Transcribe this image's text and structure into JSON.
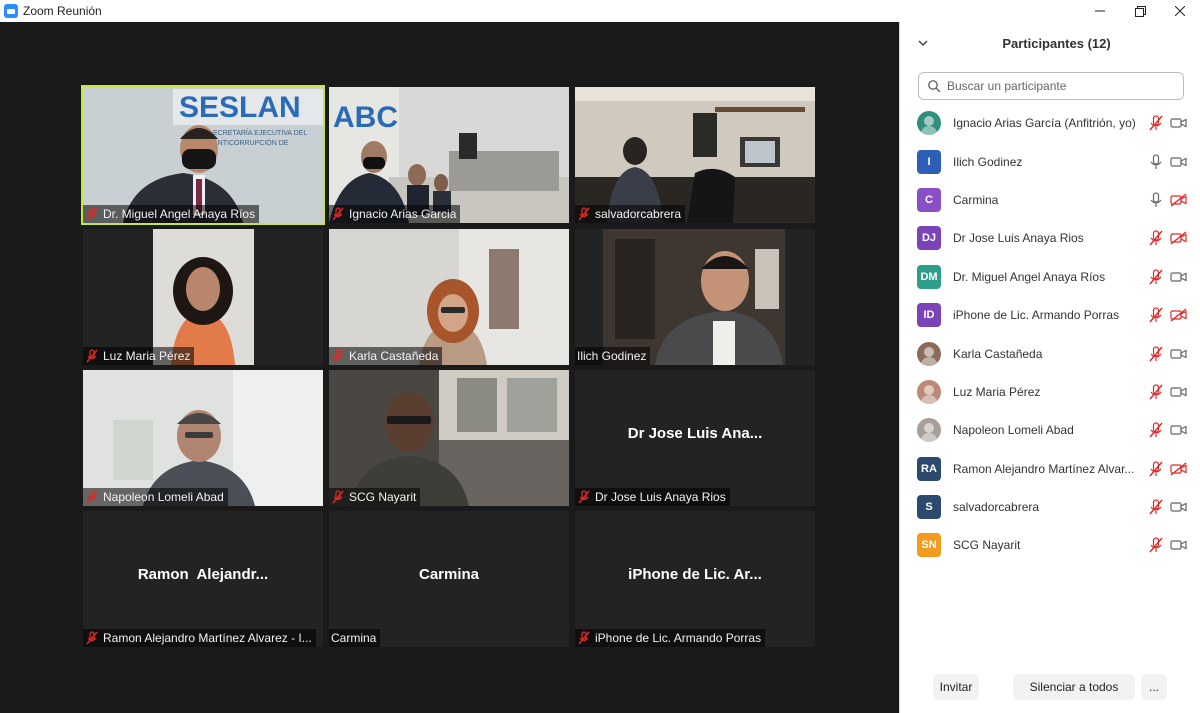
{
  "window": {
    "title": "Zoom Reunión"
  },
  "tiles": [
    {
      "label": "Dr. Miguel Angel Anaya Ríos",
      "big": ""
    },
    {
      "label": "Ignacio Arias Garcia",
      "big": ""
    },
    {
      "label": "salvadorcabrera",
      "big": ""
    },
    {
      "label": "Luz Maria Pérez",
      "big": ""
    },
    {
      "label": "Karla Castañeda",
      "big": ""
    },
    {
      "label": "Ilich Godinez",
      "big": ""
    },
    {
      "label": "Napoleon Lomeli Abad",
      "big": ""
    },
    {
      "label": "SCG Nayarit",
      "big": ""
    },
    {
      "label": "Dr Jose Luis Anaya Rios",
      "big": "Dr Jose Luis Ana..."
    },
    {
      "label": "Ramon Alejandro Martínez Alvarez - I...",
      "big": "Ramon  Alejandr..."
    },
    {
      "label": "Carmina",
      "big": "Carmina"
    },
    {
      "label": "iPhone de Lic. Armando Porras",
      "big": "iPhone de Lic. Ar..."
    }
  ],
  "panel": {
    "title": "Participantes (12)",
    "search_placeholder": "Buscar un participante",
    "participants": [
      {
        "name": "Ignacio Arias García (Anfitrión, yo)",
        "initials": "",
        "color": "#2f8f7a",
        "mic": "muted",
        "video": "on"
      },
      {
        "name": "Ilich Godinez",
        "initials": "I",
        "color": "#2e5fb8",
        "mic": "on",
        "video": "on"
      },
      {
        "name": "Carmina",
        "initials": "C",
        "color": "#8a4fc6",
        "mic": "on",
        "video": "off"
      },
      {
        "name": "Dr Jose Luis Anaya Rios",
        "initials": "DJ",
        "color": "#7a44b8",
        "mic": "muted",
        "video": "off"
      },
      {
        "name": "Dr. Miguel Angel Anaya Ríos",
        "initials": "DM",
        "color": "#2f9d8a",
        "mic": "muted",
        "video": "on"
      },
      {
        "name": "iPhone de Lic. Armando Porras",
        "initials": "ID",
        "color": "#7a44b8",
        "mic": "muted",
        "video": "off"
      },
      {
        "name": "Karla Castañeda",
        "initials": "",
        "color": "#8a6a5a",
        "mic": "muted",
        "video": "on"
      },
      {
        "name": "Luz Maria Pérez",
        "initials": "",
        "color": "#b98a78",
        "mic": "muted",
        "video": "on"
      },
      {
        "name": "Napoleon Lomeli Abad",
        "initials": "",
        "color": "#a89e98",
        "mic": "muted",
        "video": "on"
      },
      {
        "name": "Ramon Alejandro Martínez Alvar...",
        "initials": "RA",
        "color": "#2b4a6e",
        "mic": "muted",
        "video": "off"
      },
      {
        "name": "salvadorcabrera",
        "initials": "S",
        "color": "#2b4a6e",
        "mic": "muted",
        "video": "on"
      },
      {
        "name": "SCG Nayarit",
        "initials": "SN",
        "color": "#f29b1c",
        "mic": "muted",
        "video": "on"
      }
    ],
    "invite_label": "Invitar",
    "mute_all_label": "Silenciar a todos",
    "more_label": "..."
  }
}
